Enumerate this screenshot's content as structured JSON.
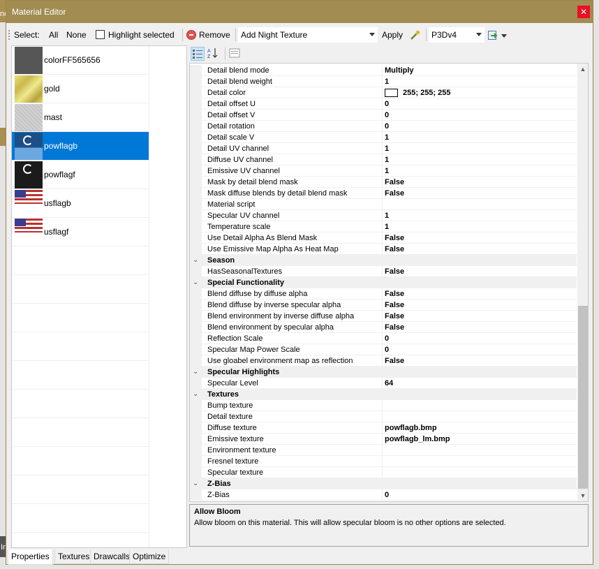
{
  "window": {
    "title": "Material Editor",
    "close_glyph": "✕"
  },
  "background": {
    "edge_text": "ne",
    "edge_text2": "In"
  },
  "toolbar": {
    "select_label": "Select:",
    "all_label": "All",
    "none_label": "None",
    "highlight_label": "Highlight selected",
    "highlight_checked": false,
    "remove_label": "Remove",
    "add_texture_value": "Add Night Texture",
    "apply_label": "Apply",
    "target_value": "P3Dv4"
  },
  "materials": [
    {
      "name": "colorFF565656",
      "thumb_color": "#565656",
      "selected": false
    },
    {
      "name": "gold",
      "thumb_color": "#d9cf6a",
      "selected": false
    },
    {
      "name": "mast",
      "thumb_color": "#c8c8c8",
      "selected": false
    },
    {
      "name": "powflagb",
      "thumb_color": "#1a4f86",
      "selected": true
    },
    {
      "name": "powflagf",
      "thumb_color": "#1b1b1b",
      "selected": false
    },
    {
      "name": "usflagb",
      "thumb_color": "#a63a3a",
      "selected": false
    },
    {
      "name": "usflagf",
      "thumb_color": "#a63a3a",
      "selected": false
    }
  ],
  "properties": [
    {
      "kind": "prop",
      "name": "Detail blend mode",
      "value": "Multiply"
    },
    {
      "kind": "prop",
      "name": "Detail blend weight",
      "value": "1"
    },
    {
      "kind": "prop",
      "name": "Detail color",
      "value": "255; 255; 255",
      "swatch": "#ffffff"
    },
    {
      "kind": "prop",
      "name": "Detail offset U",
      "value": "0"
    },
    {
      "kind": "prop",
      "name": "Detail offset V",
      "value": "0"
    },
    {
      "kind": "prop",
      "name": "Detail rotation",
      "value": "0"
    },
    {
      "kind": "prop",
      "name": "Detail scale V",
      "value": "1"
    },
    {
      "kind": "prop",
      "name": "Detail UV channel",
      "value": "1"
    },
    {
      "kind": "prop",
      "name": "Diffuse UV channel",
      "value": "1"
    },
    {
      "kind": "prop",
      "name": "Emissive UV channel",
      "value": "1"
    },
    {
      "kind": "prop",
      "name": "Mask by detail blend mask",
      "value": "False"
    },
    {
      "kind": "prop",
      "name": "Mask diffuse blends by detail blend mask",
      "value": "False"
    },
    {
      "kind": "prop",
      "name": "Material script",
      "value": ""
    },
    {
      "kind": "prop",
      "name": "Specular UV channel",
      "value": "1"
    },
    {
      "kind": "prop",
      "name": "Temperature scale",
      "value": "1"
    },
    {
      "kind": "prop",
      "name": "Use Detail Alpha As Blend Mask",
      "value": "False"
    },
    {
      "kind": "prop",
      "name": "Use Emissive Map Alpha As Heat Map",
      "value": "False"
    },
    {
      "kind": "cat",
      "name": "Season"
    },
    {
      "kind": "prop",
      "name": "HasSeasonalTextures",
      "value": "False"
    },
    {
      "kind": "cat",
      "name": "Special Functionality"
    },
    {
      "kind": "prop",
      "name": "Blend diffuse by diffuse alpha",
      "value": "False"
    },
    {
      "kind": "prop",
      "name": "Blend diffuse by inverse specular alpha",
      "value": "False"
    },
    {
      "kind": "prop",
      "name": "Blend environment by inverse diffuse alpha",
      "value": "False"
    },
    {
      "kind": "prop",
      "name": "Blend environment by specular alpha",
      "value": "False"
    },
    {
      "kind": "prop",
      "name": "Reflection Scale",
      "value": "0"
    },
    {
      "kind": "prop",
      "name": "Specular Map Power Scale",
      "value": "0"
    },
    {
      "kind": "prop",
      "name": "Use gloabel environment map as reflection",
      "value": "False"
    },
    {
      "kind": "cat",
      "name": "Specular Highlights"
    },
    {
      "kind": "prop",
      "name": "Specular Level",
      "value": "64"
    },
    {
      "kind": "cat",
      "name": "Textures"
    },
    {
      "kind": "prop",
      "name": "Bump texture",
      "value": ""
    },
    {
      "kind": "prop",
      "name": "Detail texture",
      "value": ""
    },
    {
      "kind": "prop",
      "name": "Diffuse texture",
      "value": "powflagb.bmp"
    },
    {
      "kind": "prop",
      "name": "Emissive texture",
      "value": "powflagb_lm.bmp"
    },
    {
      "kind": "prop",
      "name": "Environment texture",
      "value": ""
    },
    {
      "kind": "prop",
      "name": "Fresnel texture",
      "value": ""
    },
    {
      "kind": "prop",
      "name": "Specular texture",
      "value": ""
    },
    {
      "kind": "cat",
      "name": "Z-Bias"
    },
    {
      "kind": "prop",
      "name": "Z-Bias",
      "value": "0"
    }
  ],
  "help": {
    "title": "Allow Bloom",
    "description": "Allow bloom on this material. This will allow specular bloom is no other options are selected."
  },
  "tabs": [
    {
      "label": "Properties",
      "active": true
    },
    {
      "label": "Textures",
      "active": false
    },
    {
      "label": "Drawcalls",
      "active": false
    },
    {
      "label": "Optimize",
      "active": false
    }
  ],
  "icons": {
    "categorized": "categorized-icon",
    "alphabetical": "alphabetical-sort-icon",
    "property_pages": "property-pages-icon",
    "collapse": "chevron-down-icon",
    "scroll_up": "▲",
    "scroll_down": "▼"
  }
}
